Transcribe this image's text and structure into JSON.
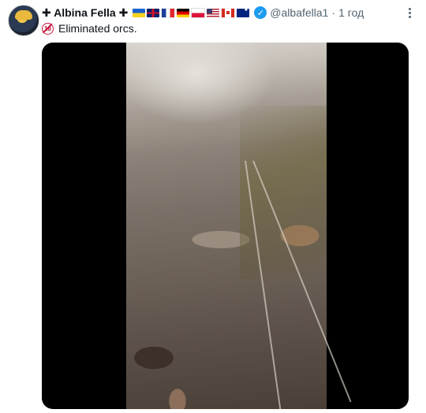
{
  "tweet": {
    "author_name": "✚ Albina Fella ✚",
    "handle": "@albafella1",
    "separator": "·",
    "timestamp": "1 год",
    "text": "Eliminated orcs.",
    "age_badge": "18",
    "flags": [
      "ua",
      "gb",
      "fr",
      "de",
      "pl",
      "us",
      "ca",
      "au"
    ],
    "verified_mark": "✓"
  },
  "colors": {
    "verified": "#1d9bf0",
    "age_badge": "#c2193d",
    "secondary_text": "#536471"
  },
  "icons": {
    "verified": "verified-badge-icon",
    "more": "more-options-icon",
    "age": "age-restriction-icon"
  }
}
